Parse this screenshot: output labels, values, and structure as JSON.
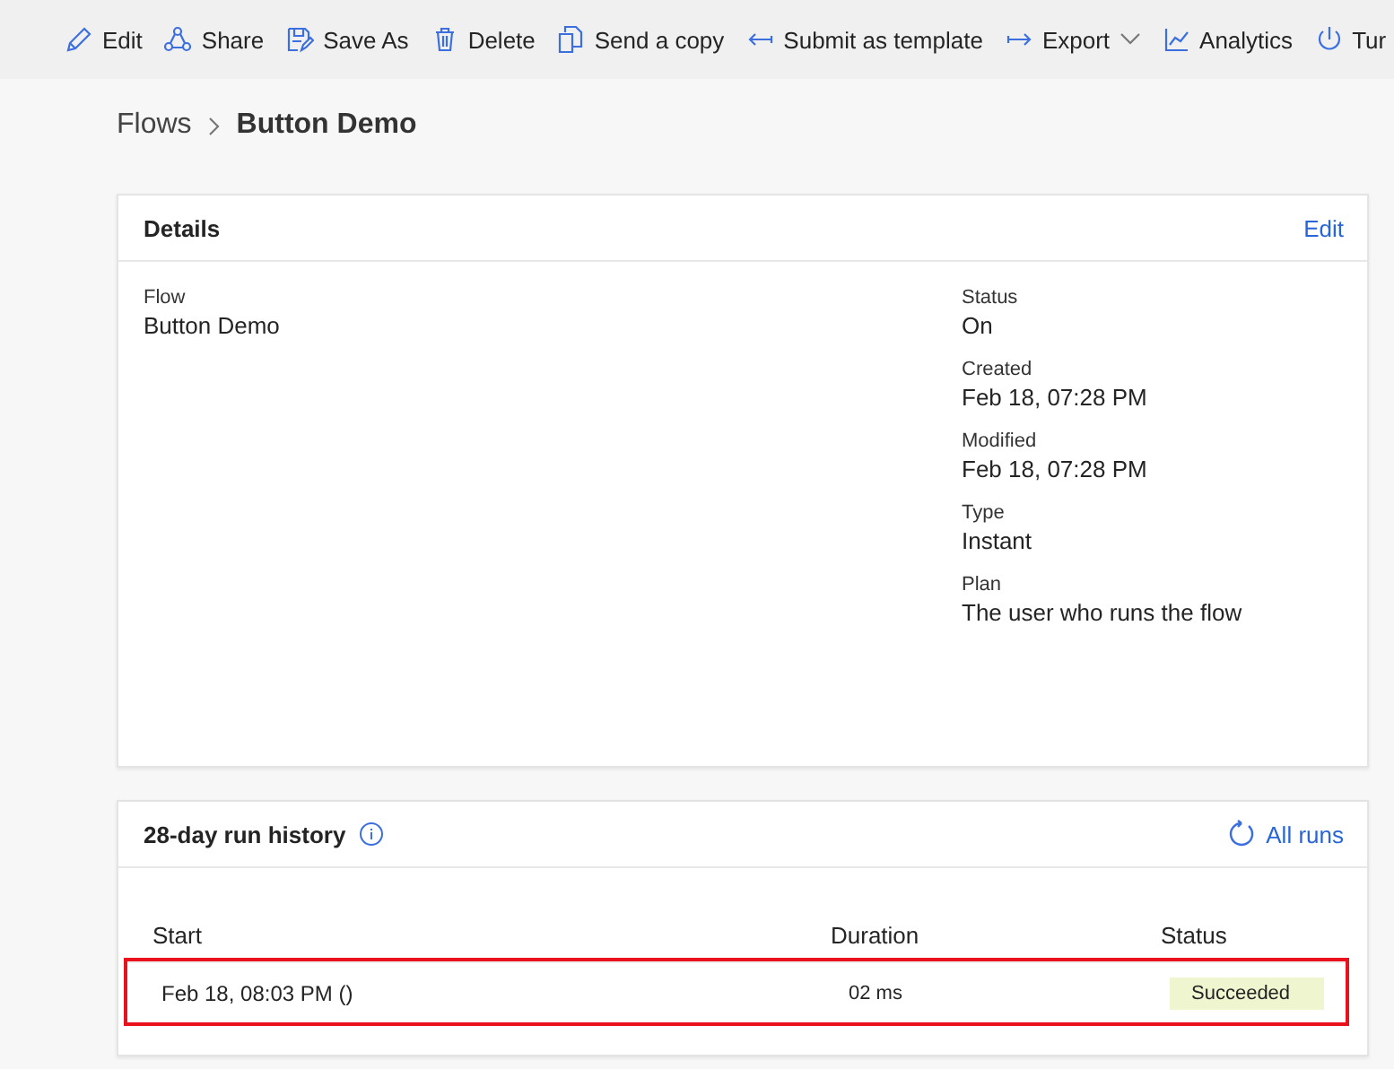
{
  "toolbar": [
    {
      "kind": "pencil",
      "label": "Edit"
    },
    {
      "kind": "share",
      "label": "Share"
    },
    {
      "kind": "saveas",
      "label": "Save As"
    },
    {
      "kind": "trash",
      "label": "Delete"
    },
    {
      "kind": "copy",
      "label": "Send a copy"
    },
    {
      "kind": "arrowleft",
      "label": "Submit as template"
    },
    {
      "kind": "arrowright",
      "label": "Export",
      "dropdown": true
    },
    {
      "kind": "chart",
      "label": "Analytics"
    },
    {
      "kind": "power",
      "label": "Tur"
    }
  ],
  "breadcrumb": {
    "parent": "Flows",
    "current": "Button Demo"
  },
  "details": {
    "title": "Details",
    "action": "Edit",
    "left": [
      {
        "label": "Flow",
        "value": "Button Demo"
      }
    ],
    "right": [
      {
        "label": "Status",
        "value": "On"
      },
      {
        "label": "Created",
        "value": "Feb 18, 07:28 PM"
      },
      {
        "label": "Modified",
        "value": "Feb 18, 07:28 PM"
      },
      {
        "label": "Type",
        "value": "Instant"
      },
      {
        "label": "Plan",
        "value": "The user who runs the flow"
      }
    ]
  },
  "run_history": {
    "title": "28-day run history",
    "action": "All runs",
    "columns": [
      "Start",
      "Duration",
      "Status"
    ],
    "rows": [
      {
        "start": "Feb 18, 08:03 PM ()",
        "duration": "02 ms",
        "status": "Succeeded",
        "highlighted": true
      }
    ]
  }
}
